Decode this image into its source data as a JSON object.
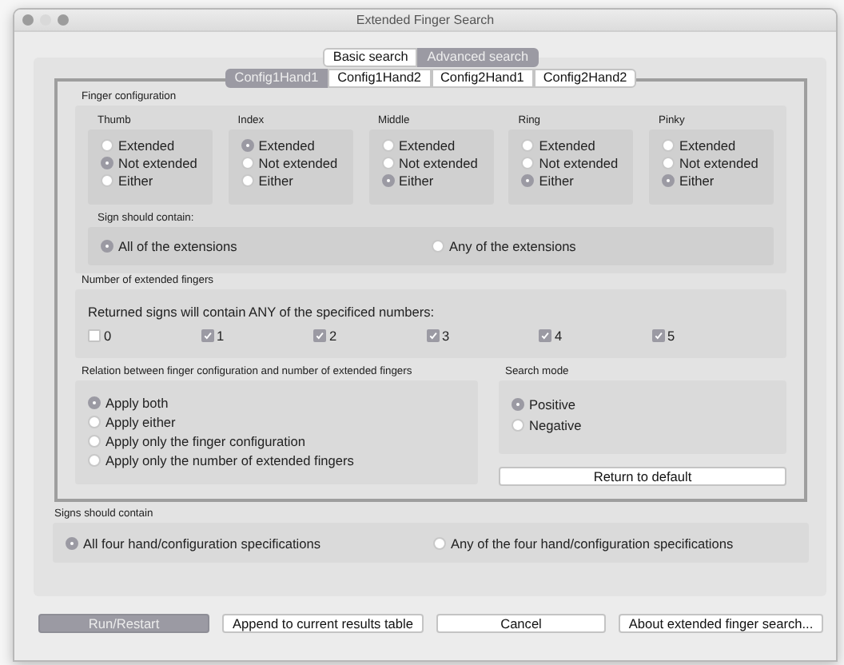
{
  "window": {
    "title": "Extended Finger Search"
  },
  "search_tabs": [
    {
      "label": "Basic search",
      "selected": false
    },
    {
      "label": "Advanced search",
      "selected": true
    }
  ],
  "config_tabs": [
    {
      "label": "Config1Hand1",
      "selected": true
    },
    {
      "label": "Config1Hand2",
      "selected": false
    },
    {
      "label": "Config2Hand1",
      "selected": false
    },
    {
      "label": "Config2Hand2",
      "selected": false
    }
  ],
  "finger_configuration": {
    "title": "Finger configuration",
    "fingers": [
      {
        "name": "Thumb",
        "options": [
          {
            "label": "Extended",
            "selected": false
          },
          {
            "label": "Not extended",
            "selected": true
          },
          {
            "label": "Either",
            "selected": false
          }
        ]
      },
      {
        "name": "Index",
        "options": [
          {
            "label": "Extended",
            "selected": true
          },
          {
            "label": "Not extended",
            "selected": false
          },
          {
            "label": "Either",
            "selected": false
          }
        ]
      },
      {
        "name": "Middle",
        "options": [
          {
            "label": "Extended",
            "selected": false
          },
          {
            "label": "Not extended",
            "selected": false
          },
          {
            "label": "Either",
            "selected": true
          }
        ]
      },
      {
        "name": "Ring",
        "options": [
          {
            "label": "Extended",
            "selected": false
          },
          {
            "label": "Not extended",
            "selected": false
          },
          {
            "label": "Either",
            "selected": true
          }
        ]
      },
      {
        "name": "Pinky",
        "options": [
          {
            "label": "Extended",
            "selected": false
          },
          {
            "label": "Not extended",
            "selected": false
          },
          {
            "label": "Either",
            "selected": true
          }
        ]
      }
    ],
    "sign_should_contain": {
      "title": "Sign should contain:",
      "options": [
        {
          "label": "All of the extensions",
          "selected": true
        },
        {
          "label": "Any of the extensions",
          "selected": false
        }
      ]
    }
  },
  "extended_fingers": {
    "title": "Number of extended fingers",
    "description": "Returned signs will contain ANY of the specificed numbers:",
    "numbers": [
      {
        "label": "0",
        "checked": false
      },
      {
        "label": "1",
        "checked": true
      },
      {
        "label": "2",
        "checked": true
      },
      {
        "label": "3",
        "checked": true
      },
      {
        "label": "4",
        "checked": true
      },
      {
        "label": "5",
        "checked": true
      }
    ]
  },
  "relation": {
    "title": "Relation between finger configuration and number of extended fingers",
    "options": [
      {
        "label": "Apply both",
        "selected": true
      },
      {
        "label": "Apply either",
        "selected": false
      },
      {
        "label": "Apply only the finger configuration",
        "selected": false
      },
      {
        "label": "Apply only the number of extended fingers",
        "selected": false
      }
    ]
  },
  "search_mode": {
    "title": "Search mode",
    "options": [
      {
        "label": "Positive",
        "selected": true
      },
      {
        "label": "Negative",
        "selected": false
      }
    ]
  },
  "return_button": {
    "label": "Return to default"
  },
  "signs_should_contain": {
    "title": "Signs should contain",
    "options": [
      {
        "label": "All four hand/configuration specifications",
        "selected": true
      },
      {
        "label": "Any of the four hand/configuration specifications",
        "selected": false
      }
    ]
  },
  "buttons": [
    {
      "label": "Run/Restart",
      "default": true
    },
    {
      "label": "Append to current results table",
      "default": false
    },
    {
      "label": "Cancel",
      "default": false
    },
    {
      "label": "About extended finger search...",
      "default": false
    }
  ]
}
